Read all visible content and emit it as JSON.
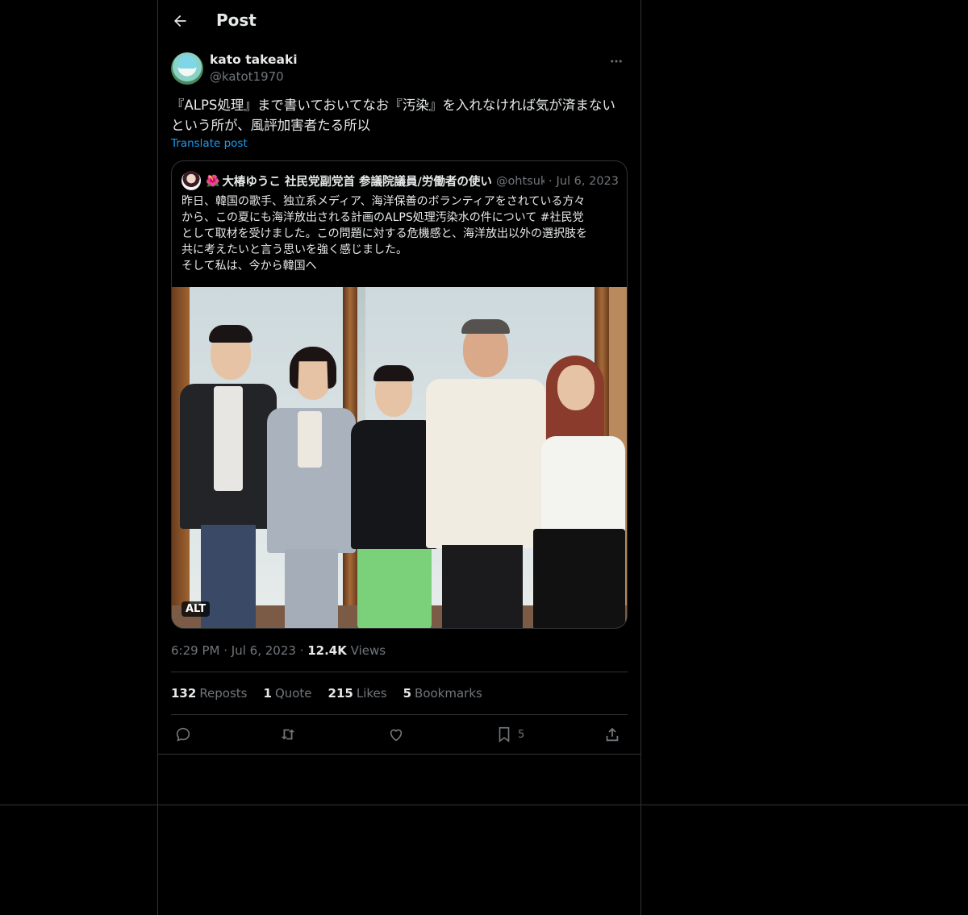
{
  "header": {
    "title": "Post"
  },
  "author": {
    "name": "kato takeaki",
    "handle": "@katot1970"
  },
  "post": {
    "text": "『ALPS処理』まで書いておいてなお『汚染』を入れなければ気が済まない\nという所が、風評加害者たる所以",
    "translate_label": "Translate post"
  },
  "quote": {
    "emoji": "🌺",
    "name": "大椿ゆうこ 社民党副党首 参議院議員/労働者の使い",
    "handle": "@ohtsuk",
    "date": "Jul 6, 2023",
    "text": "昨日、韓国の歌手、独立系メディア、海洋保善のボランティアをされている方々\nから、この夏にも海洋放出される計画のALPS処理汚染水の件について #社民党\nとして取材を受けました。この問題に対する危機感と、海洋放出以外の選択肢を\n共に考えたいと言う思いを強く感じました。\nそして私は、今から韓国へ",
    "alt_label": "ALT"
  },
  "meta": {
    "time": "6:29 PM",
    "date": "Jul 6, 2023",
    "views_count": "12.4K",
    "views_label": "Views"
  },
  "stats": {
    "reposts_count": "132",
    "reposts_label": "Reposts",
    "quotes_count": "1",
    "quotes_label": "Quote",
    "likes_count": "215",
    "likes_label": "Likes",
    "bookmarks_count": "5",
    "bookmarks_label": "Bookmarks"
  },
  "actions": {
    "bookmark_count": "5"
  },
  "icons": [
    "back-arrow-icon",
    "more-icon",
    "reply-icon",
    "repost-icon",
    "like-icon",
    "bookmark-icon",
    "share-icon"
  ],
  "colors": {
    "background": "#000000",
    "text": "#e7e9ea",
    "muted": "#71767b",
    "link": "#1d9bf0",
    "border": "#2f3336"
  }
}
